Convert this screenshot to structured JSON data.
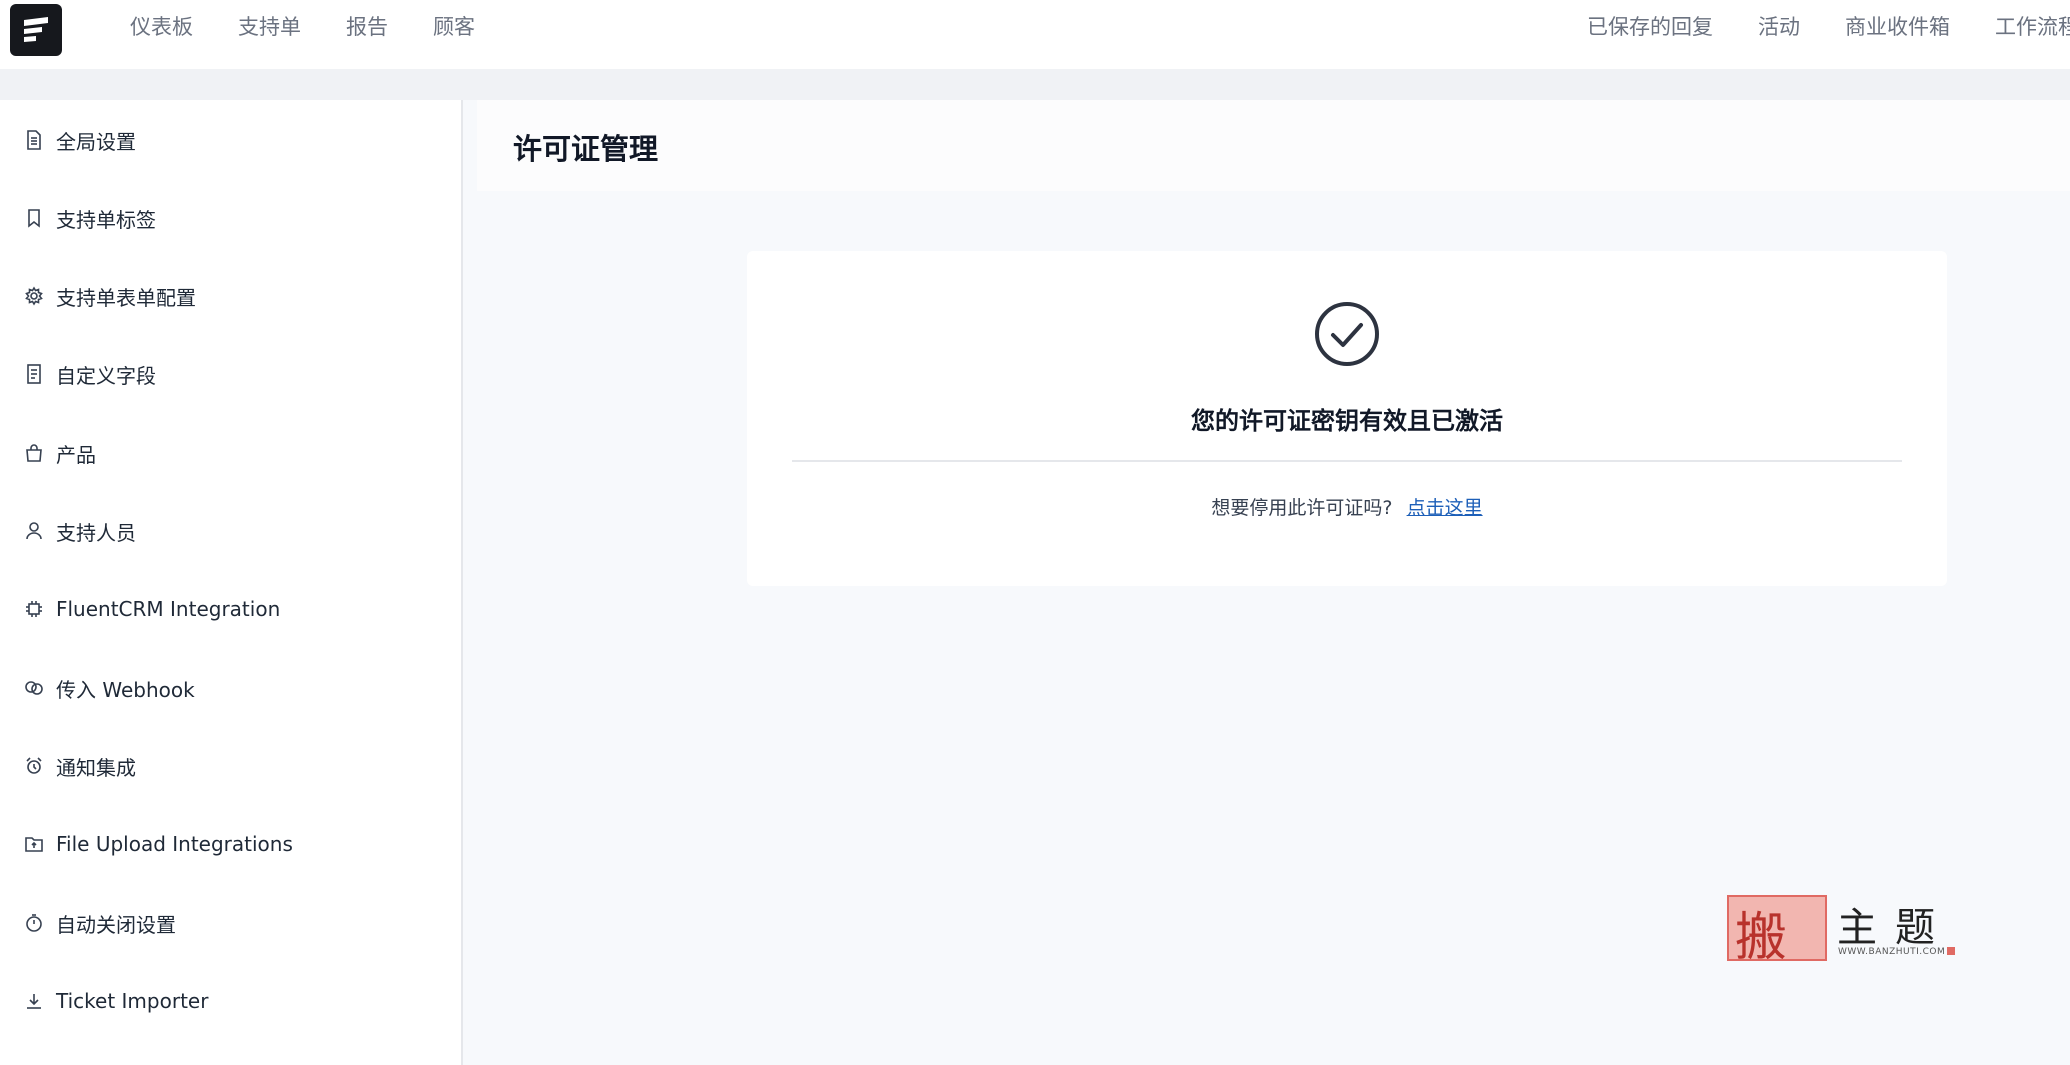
{
  "nav": {
    "left": [
      "仪表板",
      "支持单",
      "报告",
      "顾客"
    ],
    "right": [
      "已保存的回复",
      "活动",
      "商业收件箱",
      "工作流程"
    ]
  },
  "sidebar": {
    "items": [
      {
        "label": "全局设置",
        "icon": "document-icon"
      },
      {
        "label": "支持单标签",
        "icon": "bookmark-icon"
      },
      {
        "label": "支持单表单配置",
        "icon": "gear-icon"
      },
      {
        "label": "自定义字段",
        "icon": "list-document-icon"
      },
      {
        "label": "产品",
        "icon": "shopping-bag-icon"
      },
      {
        "label": "支持人员",
        "icon": "user-icon"
      },
      {
        "label": "FluentCRM Integration",
        "icon": "chip-icon"
      },
      {
        "label": "传入 Webhook",
        "icon": "webhook-icon"
      },
      {
        "label": "通知集成",
        "icon": "alarm-clock-icon"
      },
      {
        "label": "File Upload Integrations",
        "icon": "folder-upload-icon"
      },
      {
        "label": "自动关闭设置",
        "icon": "stopwatch-icon"
      },
      {
        "label": "Ticket Importer",
        "icon": "download-icon"
      }
    ]
  },
  "page": {
    "title": "许可证管理"
  },
  "license": {
    "message": "您的许可证密钥有效且已激活",
    "deactivate_prompt": "想要停用此许可证吗?",
    "deactivate_link": "点击这里"
  },
  "watermark": {
    "char1": "搬",
    "text": "主题",
    "url": "WWW.BANZHUTI.COM"
  },
  "colors": {
    "link": "#1d5fb8",
    "background": "#f7f9fc",
    "logo": "#16181d"
  }
}
